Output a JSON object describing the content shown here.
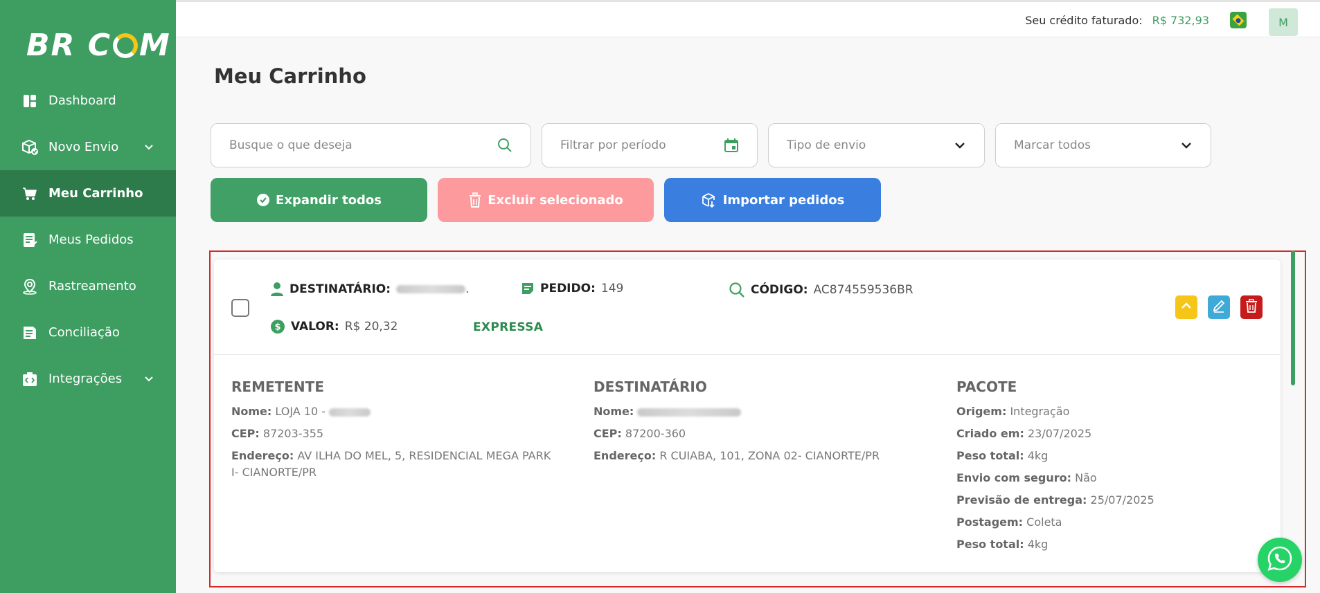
{
  "app": {
    "logo_text_1": "BR C",
    "logo_text_2": "M"
  },
  "sidebar": {
    "items": [
      {
        "label": "Dashboard",
        "icon": "dashboard-icon"
      },
      {
        "label": "Novo Envio",
        "icon": "package-icon",
        "has_submenu": true
      },
      {
        "label": "Meu Carrinho",
        "icon": "cart-icon",
        "active": true
      },
      {
        "label": "Meus Pedidos",
        "icon": "orders-icon"
      },
      {
        "label": "Rastreamento",
        "icon": "location-pin-icon"
      },
      {
        "label": "Conciliação",
        "icon": "document-icon"
      },
      {
        "label": "Integrações",
        "icon": "integration-icon",
        "has_submenu": true
      }
    ]
  },
  "topbar": {
    "credit_label": "Seu crédito faturado:",
    "credit_value": "R$ 732,93",
    "avatar_initial": "M"
  },
  "main": {
    "title": "Meu Carrinho",
    "filters": {
      "search_placeholder": "Busque o que deseja",
      "period_placeholder": "Filtrar por período",
      "shipping_type": "Tipo de envio",
      "mark_all": "Marcar todos"
    },
    "buttons": {
      "expand_all": "Expandir todos",
      "delete_selected": "Excluir selecionado",
      "import_orders": "Importar pedidos"
    }
  },
  "order": {
    "recipient_label": "DESTINATÁRIO:",
    "order_label": "PEDIDO:",
    "order_value": "149",
    "code_label": "CÓDIGO:",
    "code_value": "AC874559536BR",
    "value_label": "VALOR:",
    "value_value": "R$ 20,32",
    "service": "EXPRESSA",
    "sender": {
      "title": "REMETENTE",
      "name_label": "Nome:",
      "name_value": "LOJA 10 -",
      "cep_label": "CEP:",
      "cep_value": "87203-355",
      "address_label": "Endereço:",
      "address_line1": "AV ILHA DO MEL, 5, RESIDENCIAL MEGA PARK",
      "address_line2": "I- CIANORTE/PR"
    },
    "recipient": {
      "title": "DESTINATÁRIO",
      "name_label": "Nome:",
      "cep_label": "CEP:",
      "cep_value": "87200-360",
      "address_label": "Endereço:",
      "address_value": "R CUIABA, 101, ZONA 02- CIANORTE/PR"
    },
    "package": {
      "title": "PACOTE",
      "rows": [
        {
          "label": "Origem:",
          "value": "Integração"
        },
        {
          "label": "Criado em:",
          "value": "23/07/2025"
        },
        {
          "label": "Peso total:",
          "value": "4kg"
        },
        {
          "label": "Envio com seguro:",
          "value": "Não"
        },
        {
          "label": "Previsão de entrega:",
          "value": "25/07/2025"
        },
        {
          "label": "Postagem:",
          "value": "Coleta"
        },
        {
          "label": "Peso total:",
          "value": "4kg"
        }
      ]
    }
  },
  "colors": {
    "sidebar_bg": "#3e9e62",
    "sidebar_active": "#2d7a4b",
    "green_button": "#40a066",
    "red_button": "#fc9a9d",
    "blue_button": "#3a7fe0",
    "action_yellow": "#f5c518",
    "action_blue": "#3fa9d8",
    "action_red": "#c61b1b"
  }
}
